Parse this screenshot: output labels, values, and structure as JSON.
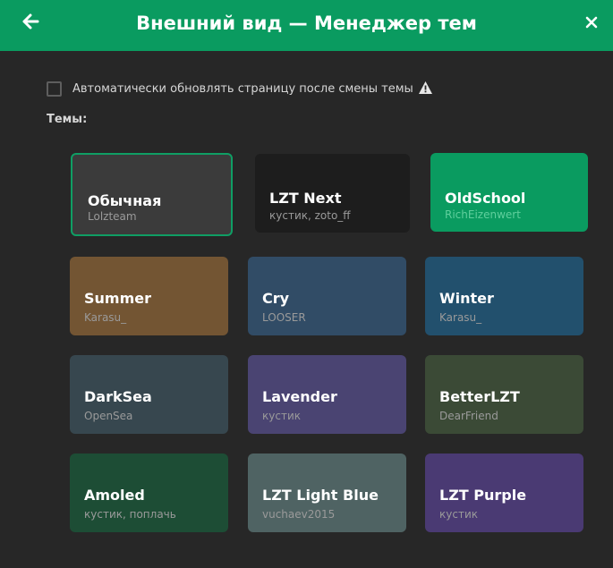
{
  "header": {
    "title": "Внешний вид — Менеджер тем",
    "back_icon": "arrow-left-icon",
    "close_icon": "close-icon",
    "color": "#0a9b60"
  },
  "auto_update": {
    "label": "Автоматически обновлять страницу после смены темы",
    "checked": false,
    "warning_icon": "warning-icon"
  },
  "themes_label": "Темы:",
  "themes": [
    {
      "name": "Обычная",
      "author": "Lolzteam",
      "color": "#3b3b3b",
      "selected": true
    },
    {
      "name": "LZT Next",
      "author": "кустик, zoto_ff",
      "color": "#1d1d1d",
      "selected": false
    },
    {
      "name": "OldSchool",
      "author": "RichEizenwert",
      "color": "#0a9b60",
      "selected": false
    },
    {
      "name": "Summer",
      "author": "Karasu_",
      "color": "#735533",
      "selected": false
    },
    {
      "name": "Cry",
      "author": "LOOSER",
      "color": "#314c66",
      "selected": false
    },
    {
      "name": "Winter",
      "author": "Karasu_",
      "color": "#22506d",
      "selected": false
    },
    {
      "name": "DarkSea",
      "author": "OpenSea",
      "color": "#37474f",
      "selected": false
    },
    {
      "name": "Lavender",
      "author": "кустик",
      "color": "#4a4472",
      "selected": false
    },
    {
      "name": "BetterLZT",
      "author": "DearFriend",
      "color": "#3b4a36",
      "selected": false
    },
    {
      "name": "Amoled",
      "author": "кустик, поплачь",
      "color": "#1d4d35",
      "selected": false
    },
    {
      "name": "LZT Light Blue",
      "author": "vuchaev2015",
      "color": "#4f6363",
      "selected": false
    },
    {
      "name": "LZT Purple",
      "author": "кустик",
      "color": "#4a3a73",
      "selected": false
    }
  ]
}
